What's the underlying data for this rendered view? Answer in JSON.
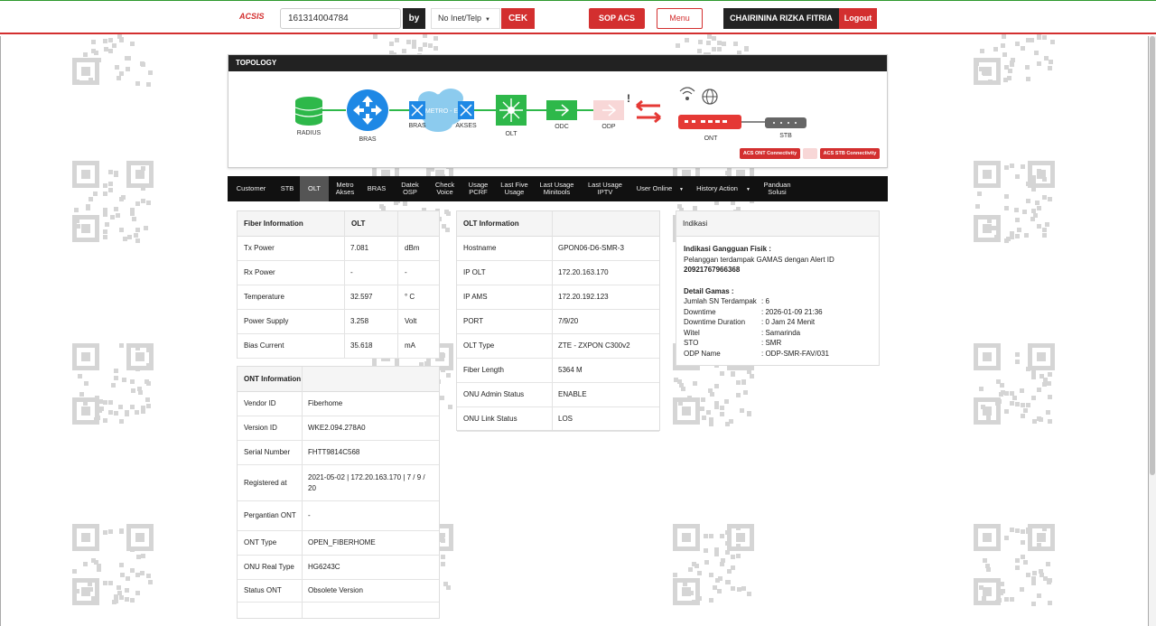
{
  "header": {
    "brand": "ACSIS",
    "search_value": "161314004784",
    "by_label": "by",
    "selector_value": "No Inet/Telp",
    "cek_label": "CEK",
    "sop_label": "SOP ACS",
    "menu_label": "Menu",
    "user_name": "CHAIRININA RIZKA FITRIA",
    "logout_label": "Logout"
  },
  "topology": {
    "title": "TOPOLOGY",
    "nodes": {
      "radius": "RADIUS",
      "bras": "BRAS",
      "bras2": "BRAS",
      "metro": "METRO - E",
      "akses": "AKSES",
      "olt": "OLT",
      "odc": "ODC",
      "odp": "ODP",
      "ont": "ONT",
      "stb": "STB"
    },
    "ont_connectivity": "ACS ONT Connectivity",
    "stb_connectivity": "ACS STB Connectivity"
  },
  "tabs": [
    {
      "l1": "Customer",
      "l2": ""
    },
    {
      "l1": "STB",
      "l2": ""
    },
    {
      "l1": "OLT",
      "l2": ""
    },
    {
      "l1": "Metro",
      "l2": "Akses"
    },
    {
      "l1": "BRAS",
      "l2": ""
    },
    {
      "l1": "Datek",
      "l2": "OSP"
    },
    {
      "l1": "Check",
      "l2": "Voice"
    },
    {
      "l1": "Usage",
      "l2": "PCRF"
    },
    {
      "l1": "Last Five",
      "l2": "Usage"
    },
    {
      "l1": "Last Usage",
      "l2": "Minitools"
    },
    {
      "l1": "Last Usage",
      "l2": "IPTV"
    },
    {
      "l1": "User Online",
      "l2": ""
    },
    {
      "l1": "History Action",
      "l2": ""
    },
    {
      "l1": "Panduan",
      "l2": "Solusi"
    }
  ],
  "fiber": {
    "title": "Fiber Information",
    "col": "OLT",
    "rows": [
      {
        "label": "Tx Power",
        "value": "7.081",
        "unit": "dBm"
      },
      {
        "label": "Rx Power",
        "value": "-",
        "unit": "-"
      },
      {
        "label": "Temperature",
        "value": "32.597",
        "unit": "° C"
      },
      {
        "label": "Power Supply",
        "value": "3.258",
        "unit": "Volt"
      },
      {
        "label": "Bias Current",
        "value": "35.618",
        "unit": "mA"
      }
    ]
  },
  "ont": {
    "title": "ONT Information",
    "rows": [
      {
        "label": "Vendor ID",
        "value": "Fiberhome"
      },
      {
        "label": "Version ID",
        "value": "WKE2.094.278A0"
      },
      {
        "label": "Serial Number",
        "value": "FHTT9814C568"
      },
      {
        "label": "Registered at",
        "value": "2021-05-02 | 172.20.163.170 | 7 / 9 / 20"
      },
      {
        "label": "Pergantian ONT",
        "value": "-"
      },
      {
        "label": "ONT Type",
        "value": "OPEN_FIBERHOME"
      },
      {
        "label": "ONU Real Type",
        "value": "HG6243C"
      },
      {
        "label": "Status ONT",
        "value": "Obsolete Version"
      }
    ]
  },
  "olt": {
    "title": "OLT Information",
    "rows": [
      {
        "label": "Hostname",
        "value": "GPON06-D6-SMR-3"
      },
      {
        "label": "IP OLT",
        "value": "172.20.163.170"
      },
      {
        "label": "IP AMS",
        "value": "172.20.192.123"
      },
      {
        "label": "PORT",
        "value": "7/9/20"
      },
      {
        "label": "OLT Type",
        "value": "ZTE - ZXPON C300v2"
      },
      {
        "label": "Fiber Length",
        "value": "5364 M"
      },
      {
        "label": "ONU Admin Status",
        "value": "ENABLE"
      },
      {
        "label": "ONU Link Status",
        "value": "LOS"
      }
    ]
  },
  "indikasi": {
    "title": "Indikasi",
    "gangguan_title": "Indikasi Gangguan Fisik :",
    "gangguan_text": "Pelanggan terdampak GAMAS dengan Alert ID",
    "alert_id": "20921767966368",
    "detail_title": "Detail Gamas :",
    "details": [
      {
        "k": "Jumlah SN Terdampak",
        "v": ": 6"
      },
      {
        "k": "Downtime",
        "v": ": 2026-01-09 21:36"
      },
      {
        "k": "Downtime Duration",
        "v": ": 0 Jam 24 Menit"
      },
      {
        "k": "Witel",
        "v": ": Samarinda"
      },
      {
        "k": "STO",
        "v": ": SMR"
      },
      {
        "k": "ODP Name",
        "v": ": ODP-SMR-FAV/031"
      }
    ]
  },
  "colors": {
    "accent": "#d32f2f",
    "dark": "#222222",
    "node_green": "#2eb84a",
    "node_blue": "#1e88e5",
    "metro_blue": "#8ccbee"
  }
}
